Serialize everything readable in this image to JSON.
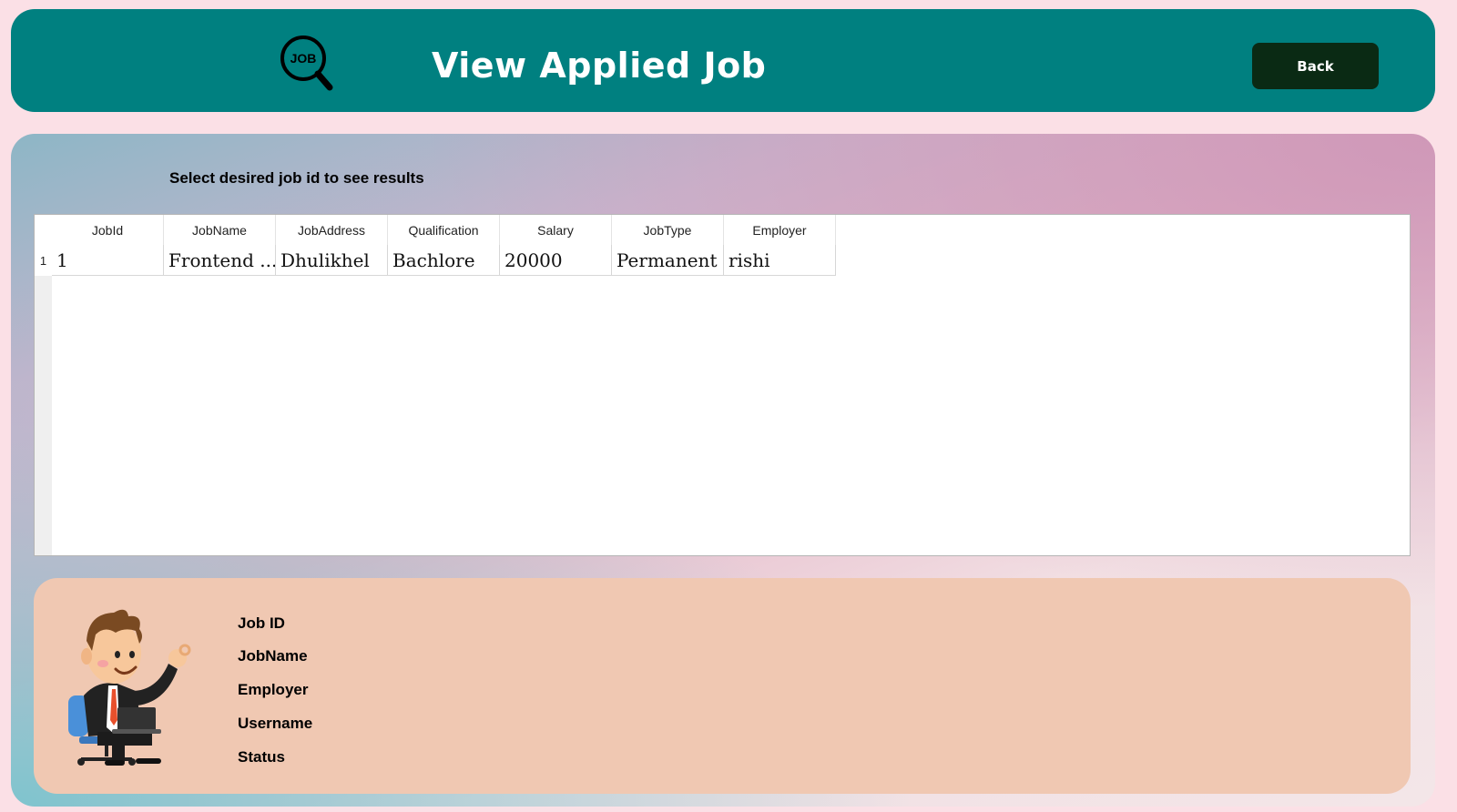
{
  "header": {
    "logo_text": "JOB",
    "title": "View Applied Job",
    "back_label": "Back"
  },
  "main": {
    "instruction": "Select desired job id to see results"
  },
  "table": {
    "columns": [
      "JobId",
      "JobName",
      "JobAddress",
      "Qualification",
      "Salary",
      "JobType",
      "Employer"
    ],
    "rows": [
      {
        "row_number": "1",
        "cells": [
          "1",
          "Frontend ...",
          "Dhulikhel",
          "Bachlore",
          "20000",
          "Permanent",
          "rishi"
        ]
      }
    ]
  },
  "details": {
    "labels": [
      "Job  ID",
      "JobName",
      "Employer",
      "Username",
      "Status"
    ]
  },
  "colors": {
    "header_bg": "#008080",
    "back_button_bg": "#0a2a14",
    "details_bg": "#f0c8b2",
    "page_bg": "#fbe0e6"
  }
}
